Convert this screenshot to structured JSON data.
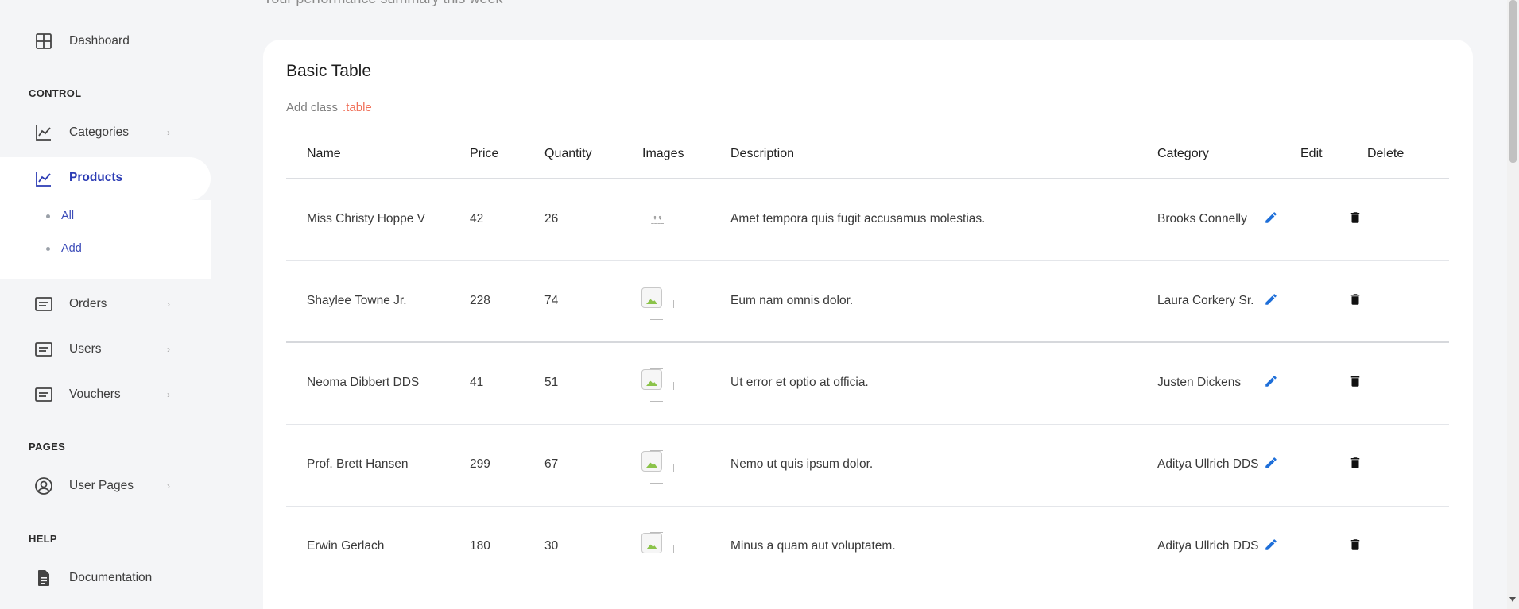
{
  "header": {
    "subtitle": "Your performance summary this week"
  },
  "sidebar": {
    "dashboard": {
      "label": "Dashboard",
      "icon": "grid-icon"
    },
    "sections": {
      "control": "CONTROL",
      "pages": "PAGES",
      "help": "HELP"
    },
    "items": [
      {
        "label": "Categories",
        "icon": "chart-line-icon",
        "chevron": "›"
      },
      {
        "label": "Products",
        "icon": "chart-line-icon",
        "active": true
      },
      {
        "label": "Orders",
        "icon": "list-box-icon",
        "chevron": "›"
      },
      {
        "label": "Users",
        "icon": "list-box-icon",
        "chevron": "›"
      },
      {
        "label": "Vouchers",
        "icon": "list-box-icon",
        "chevron": "›"
      },
      {
        "label": "User Pages",
        "icon": "user-circle-icon",
        "chevron": "›"
      },
      {
        "label": "Documentation",
        "icon": "document-icon"
      }
    ],
    "products_sub": [
      {
        "label": "All"
      },
      {
        "label": "Add"
      }
    ]
  },
  "card": {
    "title": "Basic Table",
    "sub_prefix": "Add class",
    "sub_code": ".table"
  },
  "table": {
    "headers": [
      "Name",
      "Price",
      "Quantity",
      "Images",
      "Description",
      "Category",
      "Edit",
      "Delete"
    ],
    "rows": [
      {
        "name": "Miss Christy Hoppe V",
        "price": "42",
        "quantity": "26",
        "image": "logo",
        "description": "Amet tempora quis fugit accusamus molestias.",
        "category": "Brooks Connelly"
      },
      {
        "name": "Shaylee Towne Jr.",
        "price": "228",
        "quantity": "74",
        "image": "broken",
        "description": "Eum nam omnis dolor.",
        "category": "Laura Corkery Sr."
      },
      {
        "name": "Neoma Dibbert DDS",
        "price": "41",
        "quantity": "51",
        "image": "broken",
        "description": "Ut error et optio at officia.",
        "category": "Justen Dickens"
      },
      {
        "name": "Prof. Brett Hansen",
        "price": "299",
        "quantity": "67",
        "image": "broken",
        "description": "Nemo ut quis ipsum dolor.",
        "category": "Aditya Ullrich DDS"
      },
      {
        "name": "Erwin Gerlach",
        "price": "180",
        "quantity": "30",
        "image": "broken",
        "description": "Minus a quam aut voluptatem.",
        "category": "Aditya Ullrich DDS"
      }
    ]
  },
  "colors": {
    "accent": "#2b3bb4",
    "code": "#f0715a",
    "edit": "#1e6fd9"
  }
}
